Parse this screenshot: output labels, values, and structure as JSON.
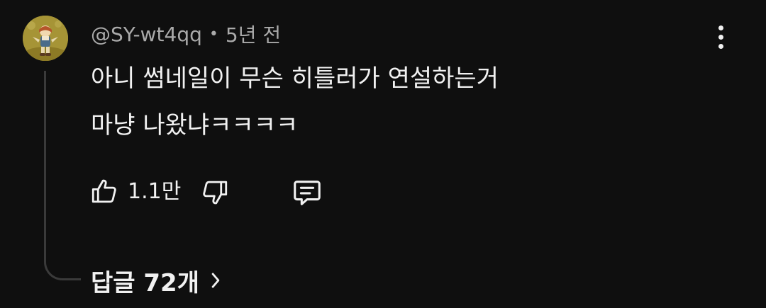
{
  "comment": {
    "author": "@SY-wt4qq",
    "separator": "•",
    "time_ago": "5년 전",
    "text_line1": "아니 썸네일이 무슨 히틀러가 연설하는거",
    "text_line2": "마냥 나왔냐ㅋㅋㅋㅋ",
    "like_count": "1.1만",
    "replies_label": "답글 72개"
  },
  "icons": {
    "avatar": "avatar-image",
    "more": "more-vert-icon",
    "like": "thumb-up-icon",
    "dislike": "thumb-down-icon",
    "reply": "comment-icon",
    "replies_chevron": "chevron-right-icon"
  },
  "colors": {
    "background": "#0f0f0f",
    "primary_text": "#f1f1f1",
    "secondary_text": "#aaaaaa",
    "thread_line": "#3a3a3a"
  }
}
